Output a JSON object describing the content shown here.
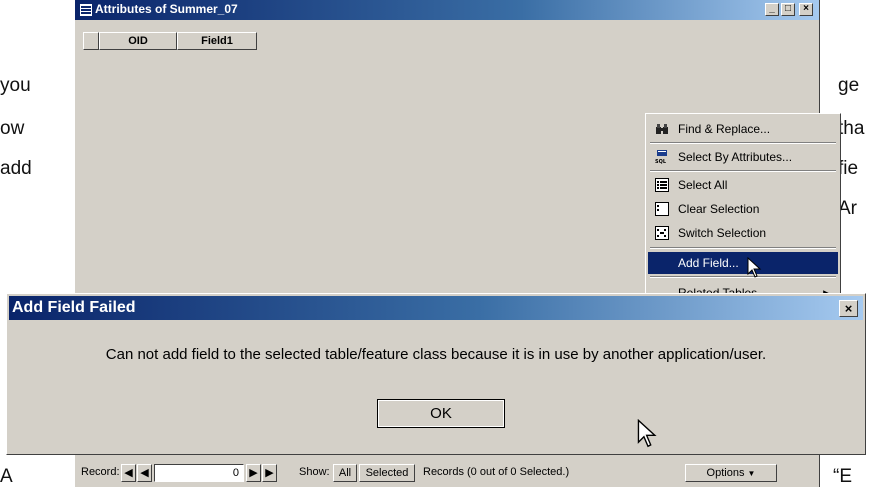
{
  "doc_text": [
    "you",
    "ow",
    "add",
    "ge",
    "tha",
    "fie",
    "Ar",
    "A",
    "“E"
  ],
  "attr_window": {
    "title": "Attributes of Summer_07",
    "columns": [
      "OID",
      "Field1"
    ],
    "caption_buttons": [
      "_",
      "□",
      "×"
    ]
  },
  "context_menu": {
    "items": [
      {
        "label": "Find & Replace...",
        "icon": "binoculars-icon"
      },
      {
        "label": "Select By Attributes...",
        "icon": "sql-icon"
      },
      {
        "label": "Select All",
        "icon": "select-all-icon"
      },
      {
        "label": "Clear Selection",
        "icon": "clear-selection-icon"
      },
      {
        "label": "Switch Selection",
        "icon": "switch-selection-icon"
      },
      {
        "label": "Add Field...",
        "icon": "",
        "selected": true
      },
      {
        "label": "Related Tables",
        "icon": "",
        "submenu": true
      }
    ]
  },
  "status_bar": {
    "record_label": "Record:",
    "record_value": "0",
    "show_label": "Show:",
    "all_button": "All",
    "selected_button": "Selected",
    "records_text": "Records (0 out of 0 Selected.)",
    "options_button": "Options"
  },
  "dialog": {
    "title": "Add Field Failed",
    "close_glyph": "×",
    "message": "Can not add field to the selected table/feature class because it is in use by another application/user.",
    "ok_label": "OK"
  },
  "colors": {
    "titlebar_active": "#0a246a",
    "window_face": "#d4d0c8",
    "menu_highlight": "#0a246a"
  }
}
